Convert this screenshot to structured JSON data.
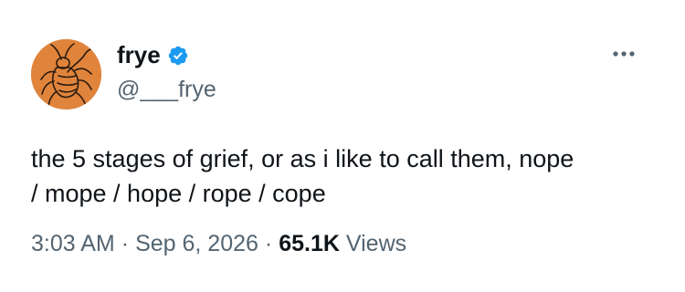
{
  "author": {
    "display_name": "frye",
    "handle": "@___frye",
    "verified": true,
    "avatar_icon": "hand-drawn-bug-avatar",
    "avatar_color": "#e0843c"
  },
  "tweet": {
    "line1": "the 5 stages of grief, or as i like to call them, nope",
    "line2": "/ mope / hope / rope / cope"
  },
  "meta": {
    "time": "3:03 AM",
    "separator": "·",
    "date": "Sep 6, 2026",
    "views_count": "65.1K",
    "views_label": "Views"
  },
  "menu": {
    "more_icon": "ellipsis-icon"
  },
  "colors": {
    "text": "#0f1419",
    "secondary": "#536471",
    "verified": "#1d9bf0"
  }
}
